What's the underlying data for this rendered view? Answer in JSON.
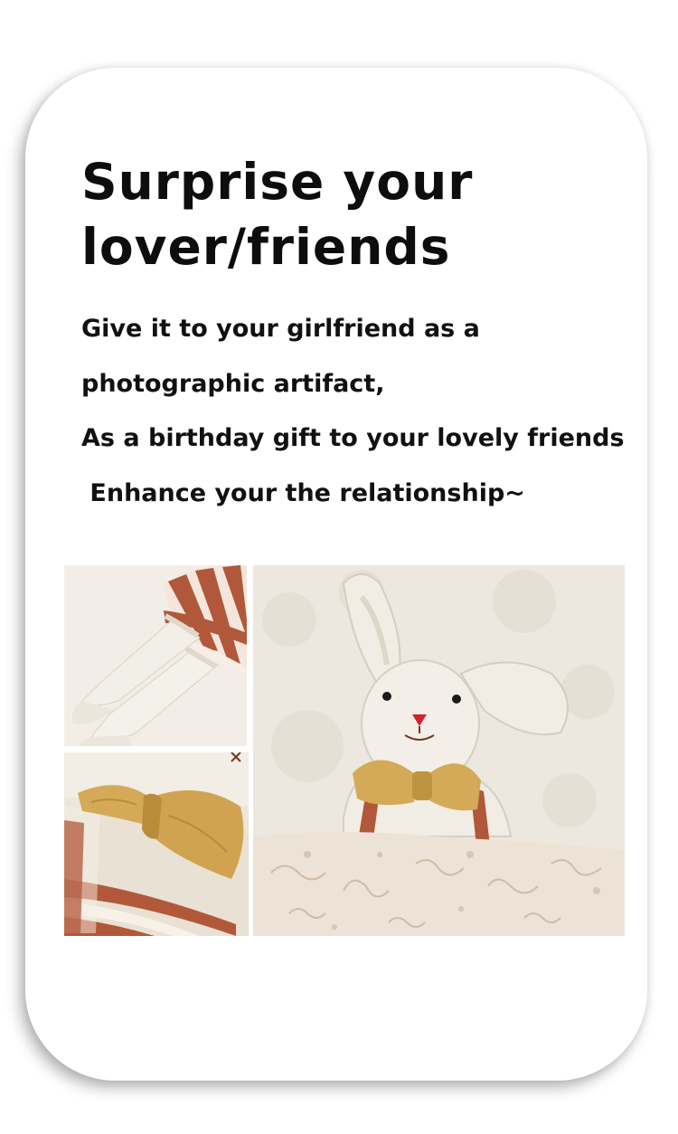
{
  "headline": {
    "line1": "Surprise your",
    "line2": "lover/friends"
  },
  "description": {
    "lines": [
      "Give it to your girlfriend as a",
      "photographic artifact,",
      "As a birthday gift to your lovely friends",
      " Enhance your the relationship~"
    ]
  },
  "gallery": {
    "images": [
      {
        "subject": "doll-legs-photo"
      },
      {
        "subject": "doll-bowtie-photo"
      },
      {
        "subject": "bunny-doll-in-bed-photo"
      }
    ]
  },
  "colors": {
    "text": "#111111",
    "stripe": "#b05a3a",
    "bowtie": "#d1a855",
    "linen": "#efe9dd",
    "nose": "#d4212a"
  }
}
